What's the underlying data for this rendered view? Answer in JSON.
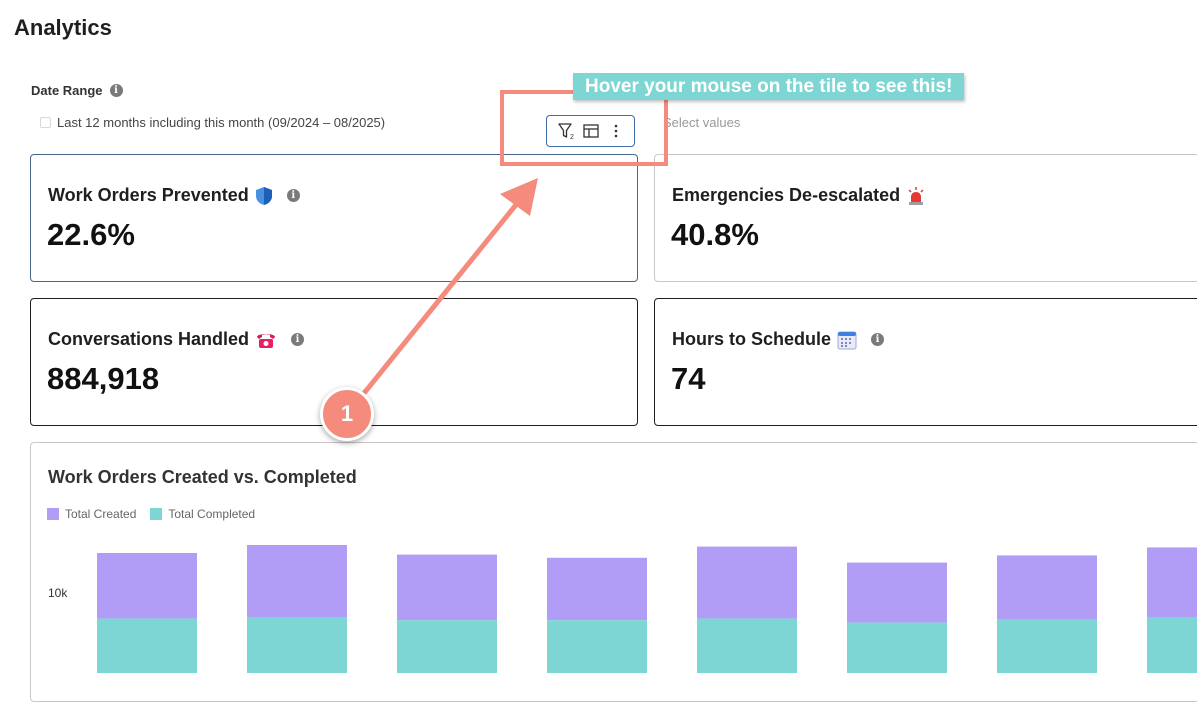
{
  "page": {
    "title": "Analytics"
  },
  "filter": {
    "label": "Date Range",
    "info_icon": "i",
    "value": "Last 12 months including this month (09/2024 – 08/2025)",
    "select_placeholder": "Select values"
  },
  "toolbar": {
    "icons": [
      "filter-icon",
      "table-icon",
      "more-vertical-icon"
    ],
    "filter_count": "2"
  },
  "tiles": [
    {
      "title": "Work Orders Prevented",
      "emoji": "shield-icon",
      "value": "22.6%"
    },
    {
      "title": "Emergencies De-escalated",
      "emoji": "siren-icon",
      "value": "40.8%"
    },
    {
      "title": "Conversations Handled",
      "emoji": "telephone-icon",
      "value": "884,918"
    },
    {
      "title": "Hours to Schedule",
      "emoji": "calendar-icon",
      "value": "74"
    }
  ],
  "chart": {
    "title": "Work Orders Created vs. Completed"
  },
  "chart_data": {
    "type": "bar",
    "stacked": true,
    "title": "Work Orders Created vs. Completed",
    "y_tick_labels": [
      "10k"
    ],
    "series": [
      {
        "name": "Total Created",
        "color": "#b19cf6",
        "values": [
          15000,
          16000,
          14800,
          14400,
          15800,
          13800,
          14700,
          15700
        ]
      },
      {
        "name": "Total Completed",
        "color": "#7dd6d3",
        "values": [
          6800,
          7000,
          6600,
          6600,
          6800,
          6300,
          6700,
          7000
        ]
      }
    ]
  },
  "annotation": {
    "tooltip": "Hover your mouse on the tile to see this!",
    "step": "1",
    "color": "#f48b7d"
  }
}
